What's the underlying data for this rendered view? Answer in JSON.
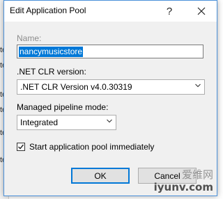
{
  "background": {
    "fragments": [
      "te",
      "te",
      "te",
      "te",
      "te",
      "te"
    ]
  },
  "dialog": {
    "title": "Edit Application Pool",
    "help_glyph": "?",
    "close_glyph": "✕"
  },
  "form": {
    "name_label": "Name:",
    "name_value": "nancymusicstore",
    "clr_label": ".NET CLR version:",
    "clr_value": ".NET CLR Version v4.0.30319",
    "pipeline_label": "Managed pipeline mode:",
    "pipeline_value": "Integrated",
    "start_immediately_label": "Start application pool immediately",
    "start_immediately_checked": true
  },
  "buttons": {
    "ok": "OK",
    "cancel": "Cancel"
  },
  "watermark": {
    "cn": "爱维网",
    "url": "iyunv.com"
  }
}
